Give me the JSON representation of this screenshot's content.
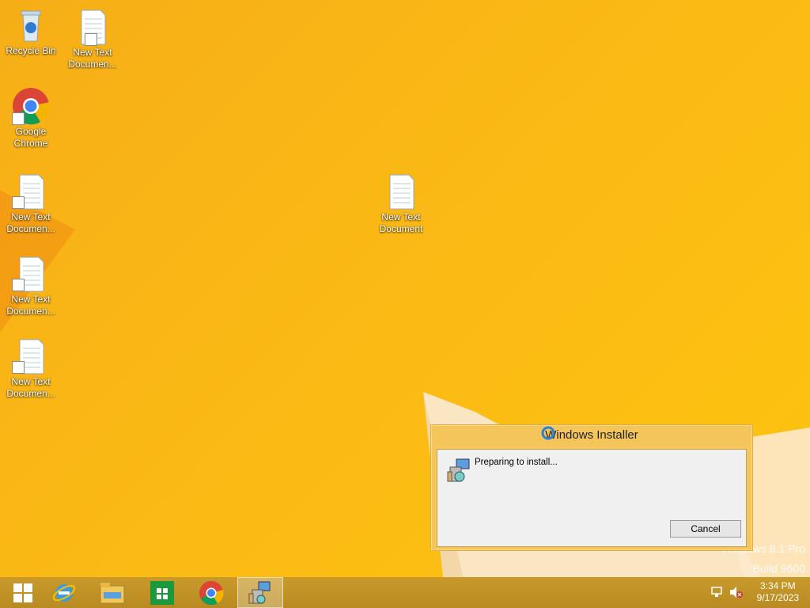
{
  "desktop": {
    "icons": [
      {
        "label": "Recycle Bin"
      },
      {
        "label": "New Text\nDocumen..."
      },
      {
        "label": "Google\nChrome"
      },
      {
        "label": "New Text\nDocumen..."
      },
      {
        "label": "New Text\nDocumen..."
      },
      {
        "label": "New Text\nDocumen..."
      },
      {
        "label": "New Text\nDocument"
      }
    ],
    "watermark": {
      "line1": "Windows 8.1 Pro",
      "line2": "Build 9600"
    }
  },
  "installer_dialog": {
    "title": "Windows Installer",
    "message": "Preparing to install...",
    "cancel_label": "Cancel"
  },
  "taskbar": {
    "clock_time": "3:34 PM",
    "clock_date": "9/17/2023"
  },
  "colors": {
    "wallpaper": "#fbb915",
    "dialog_frame": "#f3c55b"
  }
}
